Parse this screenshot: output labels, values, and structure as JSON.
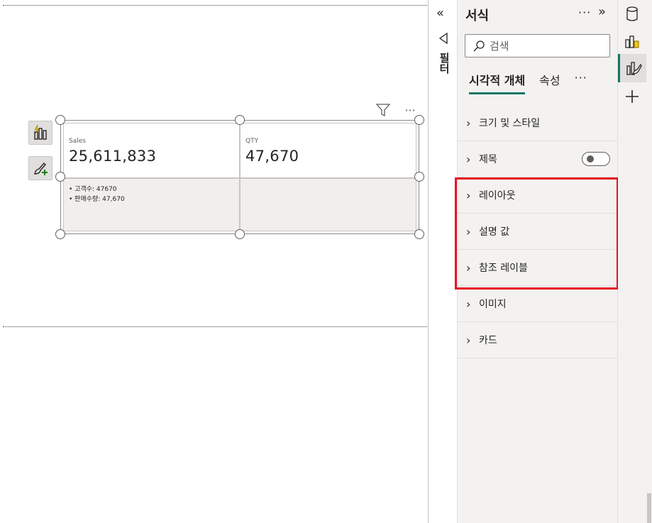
{
  "canvas": {
    "card": {
      "cells": [
        {
          "label": "Sales",
          "value": "25,611,833"
        },
        {
          "label": "QTY",
          "value": "47,670"
        }
      ],
      "reference_labels": [
        "• 고객수: 47670",
        "• 판매수량: 47,670"
      ]
    },
    "icons": {
      "visual_button_1": "lightning-chart-icon",
      "visual_button_2": "brush-add-icon",
      "header_filter": "filter-icon",
      "header_more": "more-options-icon"
    }
  },
  "filters_pane": {
    "collapse_glyph": "«",
    "label": "필터"
  },
  "format_pane": {
    "title": "서식",
    "more_glyph": "···",
    "expand_glyph": "»",
    "search": {
      "placeholder": "검색"
    },
    "tabs": [
      {
        "label": "시각적 개체",
        "active": true
      },
      {
        "label": "속성",
        "active": false
      }
    ],
    "tabs_more_glyph": "···",
    "sections": [
      {
        "label": "크기 및 스타일"
      },
      {
        "label": "제목",
        "toggle": "off"
      },
      {
        "label": "레이아웃"
      },
      {
        "label": "설명 값"
      },
      {
        "label": "참조 레이블"
      },
      {
        "label": "이미지"
      },
      {
        "label": "카드"
      }
    ],
    "highlight_color": "#e81123",
    "accent_color": "#117865"
  },
  "right_strip": {
    "icons": [
      "data-icon",
      "build-visual-icon",
      "format-visual-icon",
      "add-icon"
    ],
    "active": "format-visual-icon"
  }
}
